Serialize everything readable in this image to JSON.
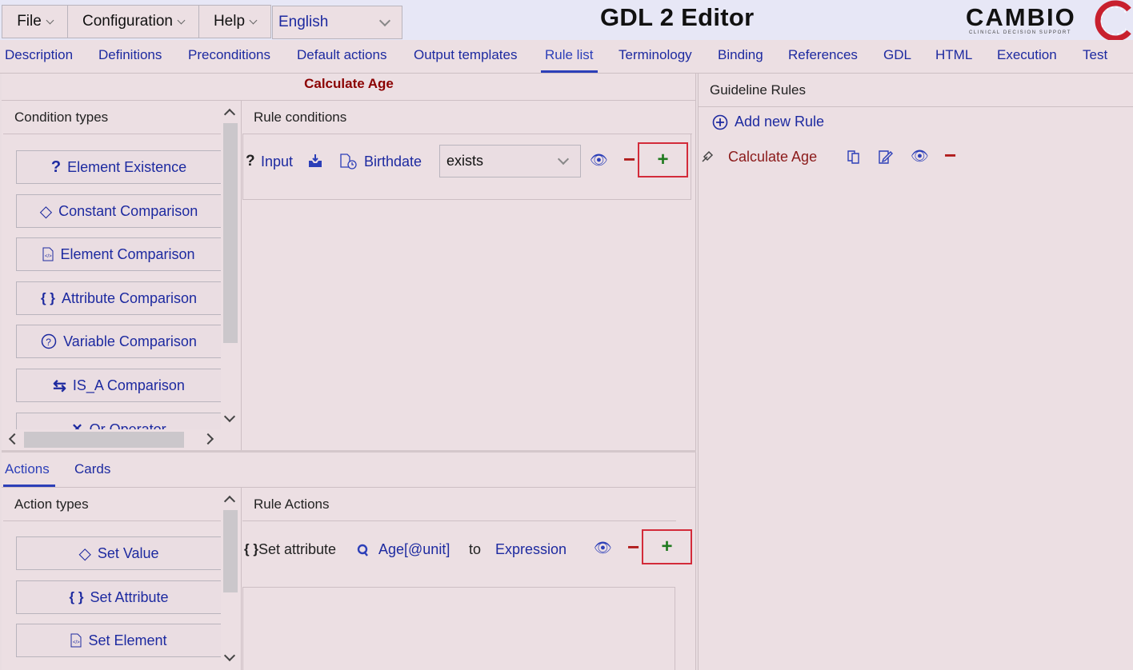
{
  "menu": {
    "file": "File",
    "configuration": "Configuration",
    "help": "Help",
    "language": "English"
  },
  "app_title": "GDL 2 Editor",
  "logo": {
    "word": "CAMBIO",
    "tagline": "CLINICAL DECISION SUPPORT"
  },
  "tabs": [
    "Description",
    "Definitions",
    "Preconditions",
    "Default actions",
    "Output templates",
    "Rule list",
    "Terminology",
    "Binding",
    "References",
    "GDL",
    "HTML",
    "Execution",
    "Test"
  ],
  "active_tab": "Rule list",
  "rule_title": "Calculate Age",
  "condition_types": {
    "header": "Condition types",
    "items": [
      "Element Existence",
      "Constant Comparison",
      "Element Comparison",
      "Attribute Comparison",
      "Variable Comparison",
      "IS_A Comparison",
      "Or Operator"
    ]
  },
  "rule_conditions": {
    "header": "Rule conditions",
    "row": {
      "prefix": "Input",
      "element": "Birthdate",
      "operator": "exists"
    }
  },
  "bottom_tabs": [
    "Actions",
    "Cards"
  ],
  "action_types": {
    "header": "Action types",
    "items": [
      "Set Value",
      "Set Attribute",
      "Set Element"
    ]
  },
  "rule_actions": {
    "header": "Rule Actions",
    "row": {
      "prefix": "Set attribute",
      "attribute": "Age[@unit]",
      "to": "to",
      "expression": "Expression"
    }
  },
  "guideline_rules": {
    "header": "Guideline Rules",
    "add_label": "Add new Rule",
    "rules": [
      "Calculate Age"
    ]
  },
  "icons": {
    "question": "?",
    "diamond": "◇",
    "braces": "{ }",
    "circle_q": "?",
    "arrows": "⇆",
    "x": "✕",
    "plus": "+",
    "minus": "−",
    "eye": "👁",
    "add_circle": "⊕"
  },
  "colors": {
    "accent_blue": "#1d2aa0",
    "rule_red": "#8b1a1a",
    "highlight_red": "#d32b3a",
    "plus_green": "#1f7a1f",
    "panel_bg": "#ecdfe3"
  }
}
